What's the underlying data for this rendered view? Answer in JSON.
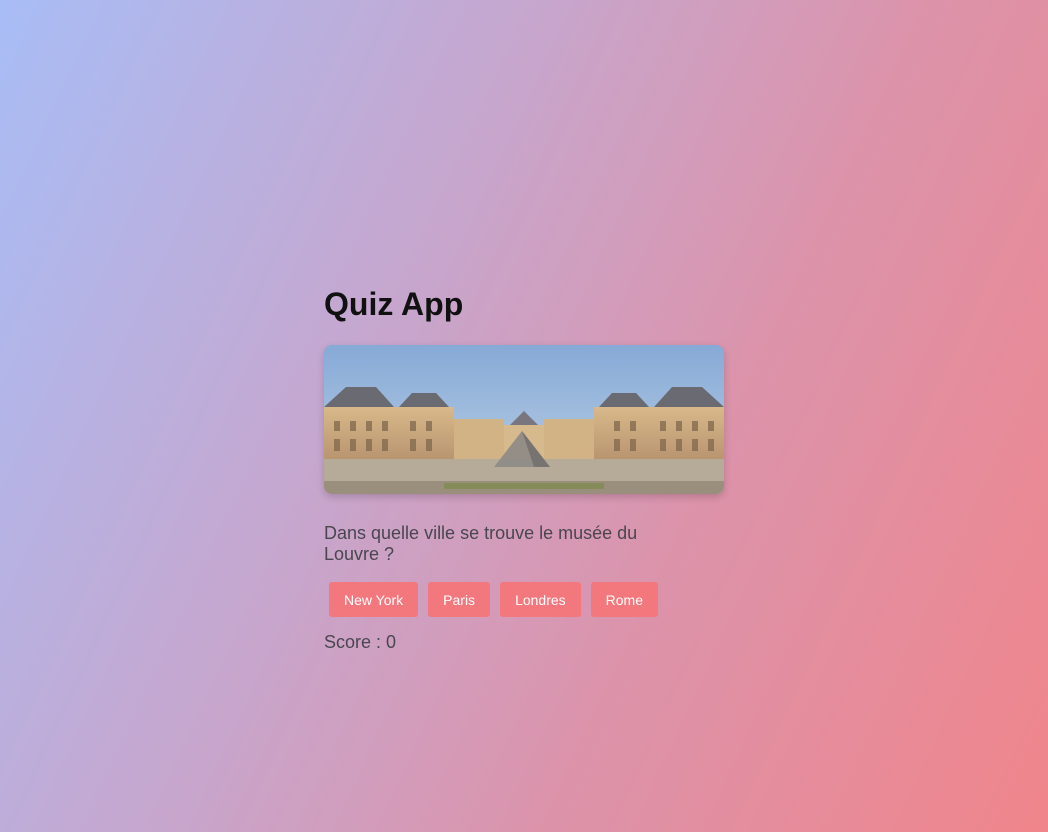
{
  "app": {
    "title": "Quiz App"
  },
  "image": {
    "subject": "Louvre museum courtyard with glass pyramid",
    "icon": "louvre-photo"
  },
  "question": {
    "text": "Dans quelle ville se trouve le musée du Louvre ?"
  },
  "answers": [
    {
      "label": "New York"
    },
    {
      "label": "Paris"
    },
    {
      "label": "Londres"
    },
    {
      "label": "Rome"
    }
  ],
  "score": {
    "text": "Score : 0"
  },
  "colors": {
    "button": "#f3787d",
    "gradient_start": "#a8bdf6",
    "gradient_end": "#f0858b"
  }
}
